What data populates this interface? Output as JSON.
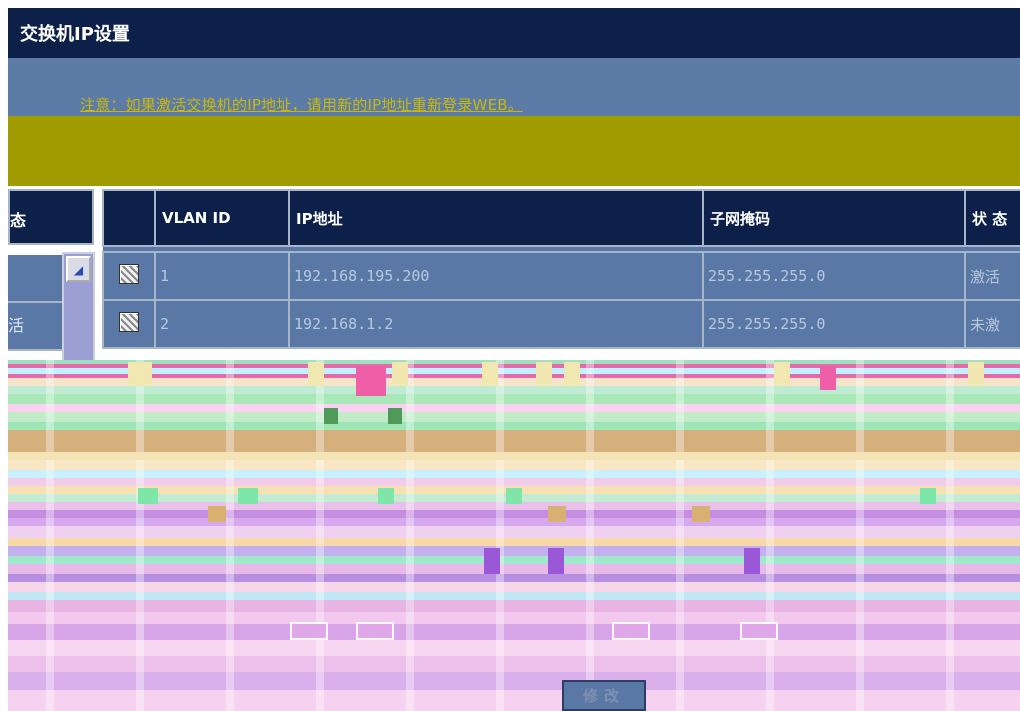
{
  "header": {
    "title": "交换机IP设置"
  },
  "notice": "注意：如果激活交换机的IP地址，请用新的IP地址重新登录WEB。",
  "left_panel": {
    "header_glyph": "态",
    "row_glyphs": [
      "",
      "活"
    ]
  },
  "table": {
    "columns": [
      "",
      "VLAN ID",
      "IP地址",
      "子网掩码",
      "状 态"
    ],
    "rows": [
      {
        "vlan_id": "1",
        "ip": "192.168.195.200",
        "mask": "255.255.255.0",
        "status": "激活"
      },
      {
        "vlan_id": "2",
        "ip": "192.168.1.2",
        "mask": "255.255.255.0",
        "status": "未激"
      }
    ]
  },
  "buttons": {
    "modify": "修改"
  },
  "icons": {
    "checkbox": "checkbox-icon",
    "scroll_up": "scroll-up-icon",
    "scroll_down": "scroll-down-icon"
  },
  "colors": {
    "title_bar": "#0c2049",
    "notice_band": "#5c7ba6",
    "olive_band": "#a09b00",
    "row_bg": "#5a78a5"
  }
}
